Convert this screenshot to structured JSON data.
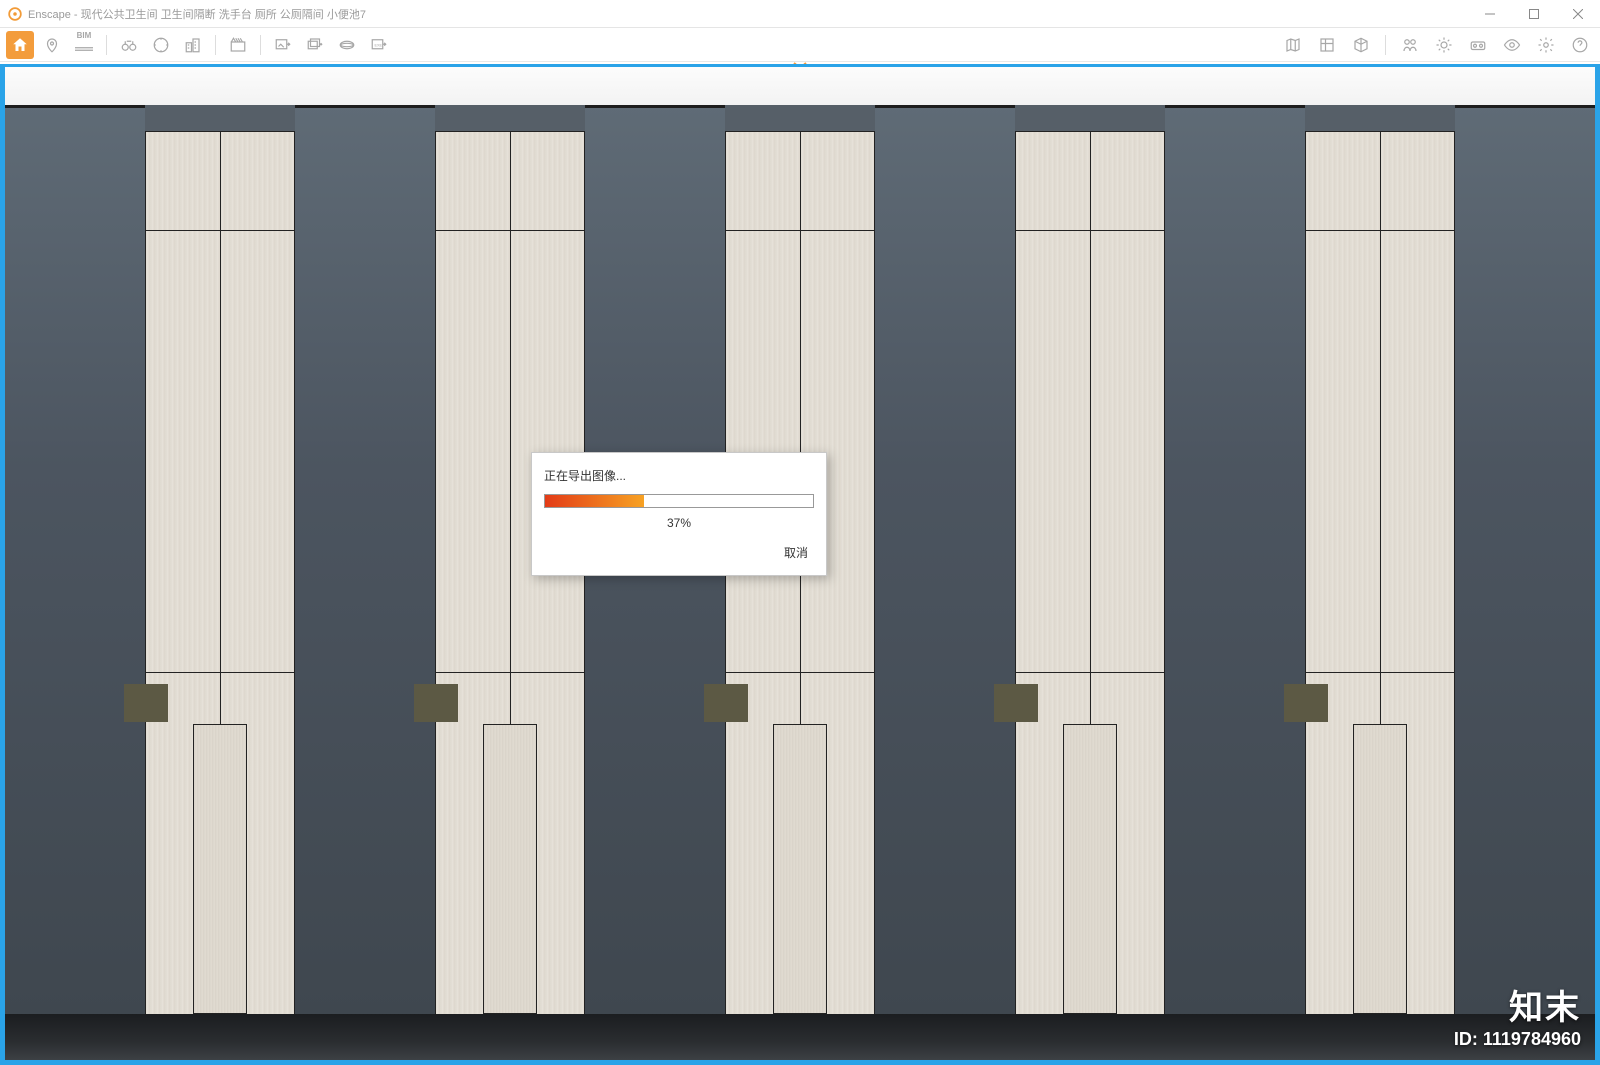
{
  "window": {
    "app": "Enscape",
    "title": "Enscape - 现代公共卫生间 卫生间隔断 洗手台 厕所 公厕隔间 小便池7"
  },
  "toolbar": {
    "bim_label": "BIM"
  },
  "dialog": {
    "title": "正在导出图像...",
    "percent_value": 37,
    "percent_text": "37%",
    "cancel_label": "取消"
  },
  "watermark": {
    "brand": "知末",
    "id_label": "ID: 1119784960"
  },
  "colors": {
    "accent": "#f39c3c",
    "viewport_border": "#2aa3e8",
    "progress_start": "#e33b17",
    "progress_end": "#f7a223"
  }
}
